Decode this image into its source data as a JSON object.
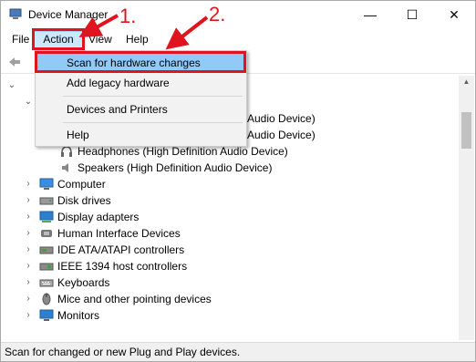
{
  "window": {
    "title": "Device Manager",
    "controls": {
      "minimize": "—",
      "maximize": "☐",
      "close": "✕"
    }
  },
  "menubar": {
    "file": "File",
    "action": "Action",
    "view": "View",
    "help": "Help"
  },
  "action_menu": {
    "items": [
      "Scan for hardware changes",
      "Add legacy hardware",
      "Devices and Printers",
      "Help"
    ]
  },
  "tree": {
    "partial_rows": [
      "Audio Device)",
      "Audio Device)"
    ],
    "audio_children": [
      "Headphones (High Definition Audio Device)",
      "Speakers (High Definition Audio Device)"
    ],
    "categories": [
      "Computer",
      "Disk drives",
      "Display adapters",
      "Human Interface Devices",
      "IDE ATA/ATAPI controllers",
      "IEEE 1394 host controllers",
      "Keyboards",
      "Mice and other pointing devices",
      "Monitors"
    ],
    "partial_prefix": [
      "ition",
      "ition"
    ]
  },
  "status": "Scan for changed or new Plug and Play devices.",
  "annotations": {
    "step1": "1.",
    "step2": "2."
  },
  "colors": {
    "highlight": "#91c9f7",
    "menu_selected": "#cce8ff",
    "annotation": "#e0141e"
  }
}
